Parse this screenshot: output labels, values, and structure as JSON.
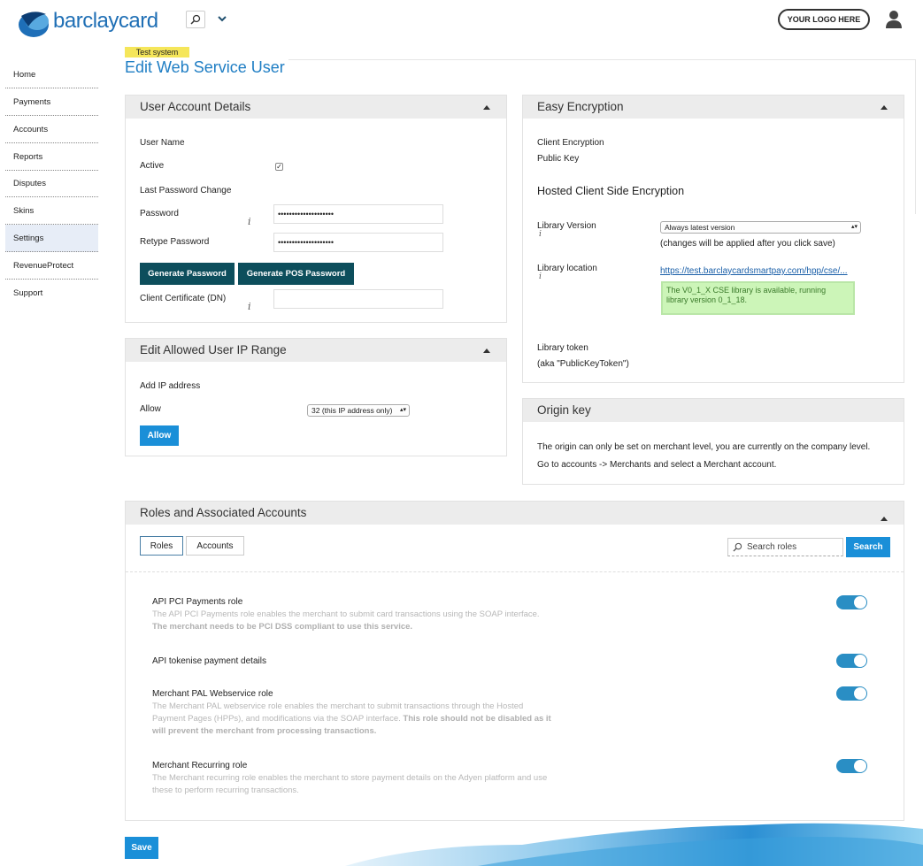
{
  "header": {
    "brand": "barclaycard",
    "your_logo": "YOUR LOGO HERE"
  },
  "sidebar": {
    "items": [
      {
        "label": "Home"
      },
      {
        "label": "Payments"
      },
      {
        "label": "Accounts"
      },
      {
        "label": "Reports"
      },
      {
        "label": "Disputes"
      },
      {
        "label": "Skins"
      },
      {
        "label": "Settings",
        "active": true
      },
      {
        "label": "RevenueProtect"
      },
      {
        "label": "Support"
      }
    ]
  },
  "page": {
    "badge": "Test system",
    "title": "Edit Web Service User"
  },
  "user_account": {
    "title": "User Account Details",
    "user_name_label": "User Name",
    "active_label": "Active",
    "last_pw_label": "Last Password Change",
    "password_label": "Password",
    "password_value": "••••••••••••••••••••",
    "retype_label": "Retype Password",
    "retype_value": "••••••••••••••••••••",
    "gen_pw_btn": "Generate Password",
    "gen_pos_btn": "Generate POS Password",
    "cert_label": "Client Certificate (DN)",
    "info": "i"
  },
  "ip_range": {
    "title": "Edit Allowed User IP Range",
    "add_label": "Add IP address",
    "allow_label": "Allow",
    "select_value": "32 (this IP address only)",
    "allow_btn": "Allow"
  },
  "easy_enc": {
    "title": "Easy Encryption",
    "client_enc": "Client Encryption",
    "public_key": "Public Key",
    "hosted_title": "Hosted Client Side Encryption",
    "lib_version_label": "Library Version",
    "lib_version_value": "Always latest version",
    "lib_note": "(changes will be applied after you click save)",
    "lib_location_label": "Library location",
    "lib_location_link": "https://test.barclaycardsmartpay.com/hpp/cse/...",
    "success_msg": "The V0_1_X CSE library is available, running library version 0_1_18.",
    "token_label": "Library token",
    "token_sub": "(aka \"PublicKeyToken\")"
  },
  "origin_key": {
    "title": "Origin key",
    "line1": "The origin can only be set on merchant level, you are currently on the company level.",
    "line2": "Go to accounts -> Merchants and select a Merchant account."
  },
  "roles": {
    "title": "Roles and Associated Accounts",
    "tab_roles": "Roles",
    "tab_accounts": "Accounts",
    "search_placeholder": "Search roles",
    "search_btn": "Search",
    "items": [
      {
        "title": "API PCI Payments role",
        "desc": "The API PCI Payments role enables the merchant to submit card transactions using the SOAP interface.",
        "bold": "The merchant needs to be PCI DSS compliant to use this service."
      },
      {
        "title": "API tokenise payment details",
        "desc": "",
        "bold": ""
      },
      {
        "title": "Merchant PAL Webservice role",
        "desc": "The Merchant PAL webservice role enables the merchant to submit transactions through the Hosted Payment Pages (HPPs), and modifications via the SOAP interface.",
        "bold": "This role should not be disabled as it will prevent the merchant from processing transactions."
      },
      {
        "title": "Merchant Recurring role",
        "desc": "The Merchant recurring role enables the merchant to store payment details on the Adyen platform and use these to perform recurring transactions.",
        "bold": ""
      }
    ]
  },
  "save_btn": "Save",
  "colors": {
    "accent": "#1a8fd8",
    "dark_button": "#0d4e5c",
    "toggle_on": "#2a8ec4",
    "success_bg": "#ccf5b8"
  }
}
